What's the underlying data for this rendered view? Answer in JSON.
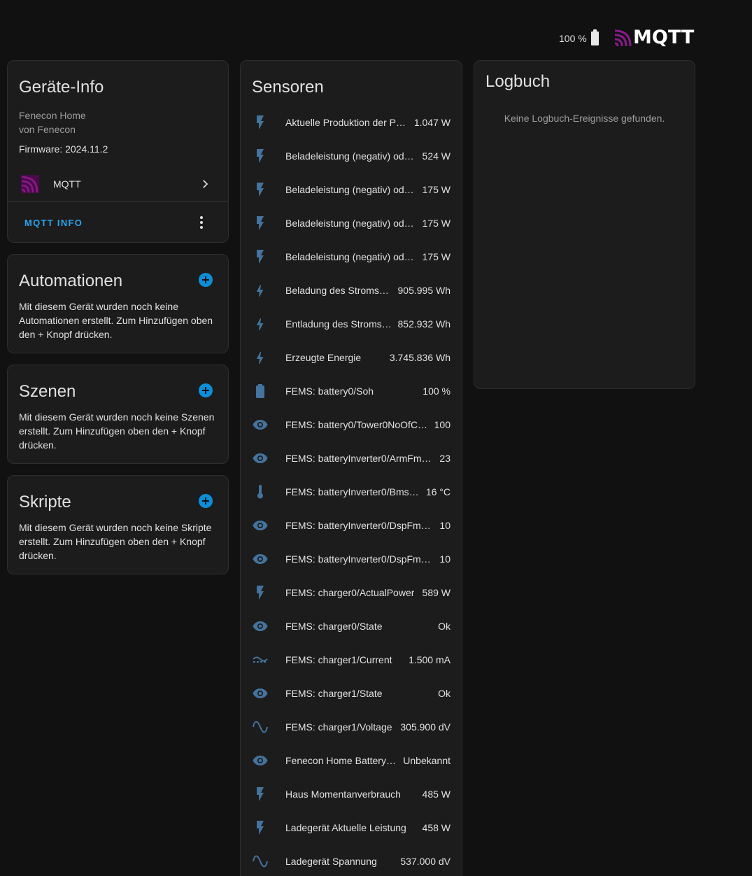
{
  "header": {
    "battery_level": "100 %",
    "brand": "MQTT"
  },
  "device_info": {
    "title": "Geräte-Info",
    "model": "Fenecon Home",
    "manufacturer": "von Fenecon",
    "firmware": "Firmware: 2024.11.2",
    "integration_label": "MQTT",
    "info_button": "MQTT INFO"
  },
  "automations": {
    "title": "Automationen",
    "description": "Mit diesem Gerät wurden noch keine Automationen erstellt. Zum Hinzufügen oben den + Knopf drücken."
  },
  "scenes": {
    "title": "Szenen",
    "description": "Mit diesem Gerät wurden noch keine Szenen erstellt. Zum Hinzufügen oben den + Knopf drücken."
  },
  "scripts": {
    "title": "Skripte",
    "description": "Mit diesem Gerät wurden noch keine Skripte erstellt. Zum Hinzufügen oben den + Knopf drücken."
  },
  "sensors": {
    "title": "Sensoren",
    "items": [
      {
        "icon": "flash-icon",
        "name": "Aktuelle Produktion der P…",
        "value": "1.047 W"
      },
      {
        "icon": "flash-icon",
        "name": "Beladeleistung (negativ) od…",
        "value": "524 W"
      },
      {
        "icon": "flash-icon",
        "name": "Beladeleistung (negativ) od…",
        "value": "175 W"
      },
      {
        "icon": "flash-icon",
        "name": "Beladeleistung (negativ) od…",
        "value": "175 W"
      },
      {
        "icon": "flash-icon",
        "name": "Beladeleistung (negativ) od…",
        "value": "175 W"
      },
      {
        "icon": "lightning-bolt-icon",
        "name": "Beladung des Stroms…",
        "value": "905.995 Wh"
      },
      {
        "icon": "lightning-bolt-icon",
        "name": "Entladung des Stroms…",
        "value": "852.932 Wh"
      },
      {
        "icon": "lightning-bolt-icon",
        "name": "Erzeugte Energie",
        "value": "3.745.836 Wh"
      },
      {
        "icon": "battery-icon",
        "name": "FEMS: battery0/Soh",
        "value": "100 %"
      },
      {
        "icon": "eye-icon",
        "name": "FEMS: battery0/Tower0NoOfC…",
        "value": "100"
      },
      {
        "icon": "eye-icon",
        "name": "FEMS: batteryInverter0/ArmFm…",
        "value": "23"
      },
      {
        "icon": "thermometer-icon",
        "name": "FEMS: batteryInverter0/Bms…",
        "value": "16 °C"
      },
      {
        "icon": "eye-icon",
        "name": "FEMS: batteryInverter0/DspFm…",
        "value": "10"
      },
      {
        "icon": "eye-icon",
        "name": "FEMS: batteryInverter0/DspFm…",
        "value": "10"
      },
      {
        "icon": "flash-icon",
        "name": "FEMS: charger0/ActualPower",
        "value": "589 W"
      },
      {
        "icon": "eye-icon",
        "name": "FEMS: charger0/State",
        "value": "Ok"
      },
      {
        "icon": "current-dc-icon",
        "name": "FEMS: charger1/Current",
        "value": "1.500 mA"
      },
      {
        "icon": "eye-icon",
        "name": "FEMS: charger1/State",
        "value": "Ok"
      },
      {
        "icon": "sine-wave-icon",
        "name": "FEMS: charger1/Voltage",
        "value": "305.900 dV"
      },
      {
        "icon": "eye-icon",
        "name": "Fenecon Home Battery …",
        "value": "Unbekannt"
      },
      {
        "icon": "flash-icon",
        "name": "Haus Momentanverbrauch",
        "value": "485 W"
      },
      {
        "icon": "flash-icon",
        "name": "Ladegerät Aktuelle Leistung",
        "value": "458 W"
      },
      {
        "icon": "sine-wave-icon",
        "name": "Ladegerät Spannung",
        "value": "537.000 dV"
      }
    ]
  },
  "logbook": {
    "title": "Logbuch",
    "empty_text": "Keine Logbuch-Ereignisse gefunden."
  },
  "colors": {
    "background": "#111111",
    "card": "#1c1c1c",
    "accent": "#0d8ed8",
    "icon": "#44739e",
    "mqtt_purple": "#660066"
  }
}
